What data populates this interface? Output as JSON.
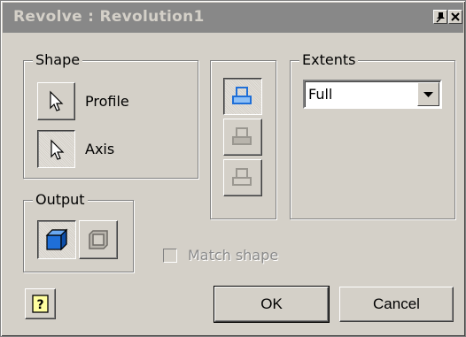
{
  "window": {
    "title": "Revolve : Revolution1"
  },
  "groups": {
    "shape": "Shape",
    "output": "Output",
    "extents": "Extents"
  },
  "shape": {
    "profile_label": "Profile",
    "axis_label": "Axis"
  },
  "extents": {
    "selected": "Full"
  },
  "match_shape": {
    "label": "Match shape",
    "checked": false,
    "enabled": false
  },
  "buttons": {
    "ok": "OK",
    "cancel": "Cancel"
  },
  "colors": {
    "dialog_bg": "#d4d0c8",
    "title_bg": "#888888",
    "accent_blue": "#1f6fd8"
  }
}
